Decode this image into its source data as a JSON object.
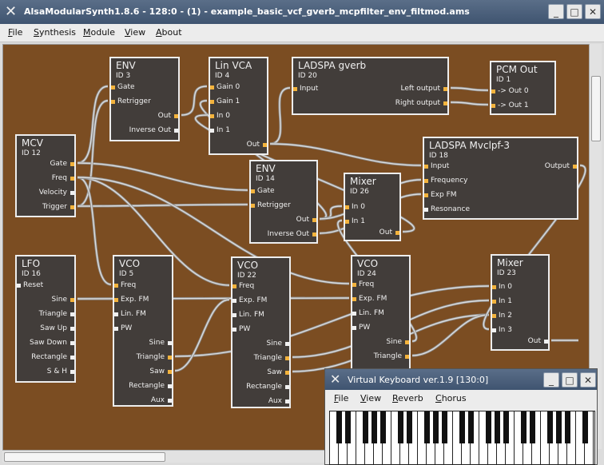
{
  "window": {
    "title": "AlsaModularSynth1.8.6 - 128:0 - (1) - example_basic_vcf_gverb_mcpfilter_env_filtmod.ams",
    "app_icon": "x-logo-icon",
    "controls": [
      "minimize-icon",
      "maximize-icon",
      "close-icon"
    ]
  },
  "menu": [
    "File",
    "Synthesis",
    "Module",
    "View",
    "About"
  ],
  "colors": {
    "canvas": "#7b4d22",
    "module": "#423d3a",
    "wire": "#c8c8c8",
    "active_port": "#f3b33d"
  },
  "modules": [
    {
      "name": "ENV",
      "id": "ID 3",
      "inputs": [
        "Gate",
        "Retrigger"
      ],
      "outputs": [
        "Out",
        "Inverse Out"
      ]
    },
    {
      "name": "Lin VCA",
      "id": "ID 4",
      "inputs": [
        "Gain 0",
        "Gain 1",
        "In 0",
        "In 1"
      ],
      "outputs": [
        "Out"
      ]
    },
    {
      "name": "LADSPA gverb",
      "id": "ID 20",
      "inputs": [
        "Input"
      ],
      "outputs": [
        "Left output",
        "Right output"
      ]
    },
    {
      "name": "PCM Out",
      "id": "ID 1",
      "inputs": [
        "-> Out  0",
        "-> Out  1"
      ],
      "outputs": []
    },
    {
      "name": "MCV",
      "id": "ID 12",
      "inputs": [],
      "outputs": [
        "Gate",
        "Freq",
        "Velocity",
        "Trigger"
      ]
    },
    {
      "name": "ENV",
      "id": "ID 14",
      "inputs": [
        "Gate",
        "Retrigger"
      ],
      "outputs": [
        "Out",
        "Inverse Out"
      ]
    },
    {
      "name": "Mixer",
      "id": "ID 26",
      "inputs": [
        "In 0",
        "In 1"
      ],
      "outputs": [
        "Out"
      ]
    },
    {
      "name": "LADSPA Mvclpf-3",
      "id": "ID 18",
      "inputs": [
        "Input",
        "Frequency",
        "Exp FM",
        "Resonance"
      ],
      "outputs": [
        "Output"
      ]
    },
    {
      "name": "LFO",
      "id": "ID 16",
      "inputs": [
        "Reset"
      ],
      "outputs": [
        "Sine",
        "Triangle",
        "Saw Up",
        "Saw Down",
        "Rectangle",
        "S & H"
      ]
    },
    {
      "name": "VCO",
      "id": "ID 5",
      "inputs": [
        "Freq",
        "Exp. FM",
        "Lin. FM",
        "PW"
      ],
      "outputs": [
        "Sine",
        "Triangle",
        "Saw",
        "Rectangle",
        "Aux"
      ]
    },
    {
      "name": "VCO",
      "id": "ID 22",
      "inputs": [
        "Freq",
        "Exp. FM",
        "Lin. FM",
        "PW"
      ],
      "outputs": [
        "Sine",
        "Triangle",
        "Saw",
        "Rectangle",
        "Aux"
      ]
    },
    {
      "name": "VCO",
      "id": "ID 24",
      "inputs": [
        "Freq",
        "Exp. FM",
        "Lin. FM",
        "PW"
      ],
      "outputs": [
        "Sine",
        "Triangle"
      ]
    },
    {
      "name": "Mixer",
      "id": "ID 23",
      "inputs": [
        "In 0",
        "In 1",
        "In 2",
        "In 3"
      ],
      "outputs": [
        "Out"
      ]
    }
  ],
  "keyboard": {
    "title": "Virtual Keyboard ver.1.9 [130:0]",
    "app_icon": "x-logo-icon",
    "menu": [
      "File",
      "View",
      "Reverb",
      "Chorus"
    ]
  }
}
